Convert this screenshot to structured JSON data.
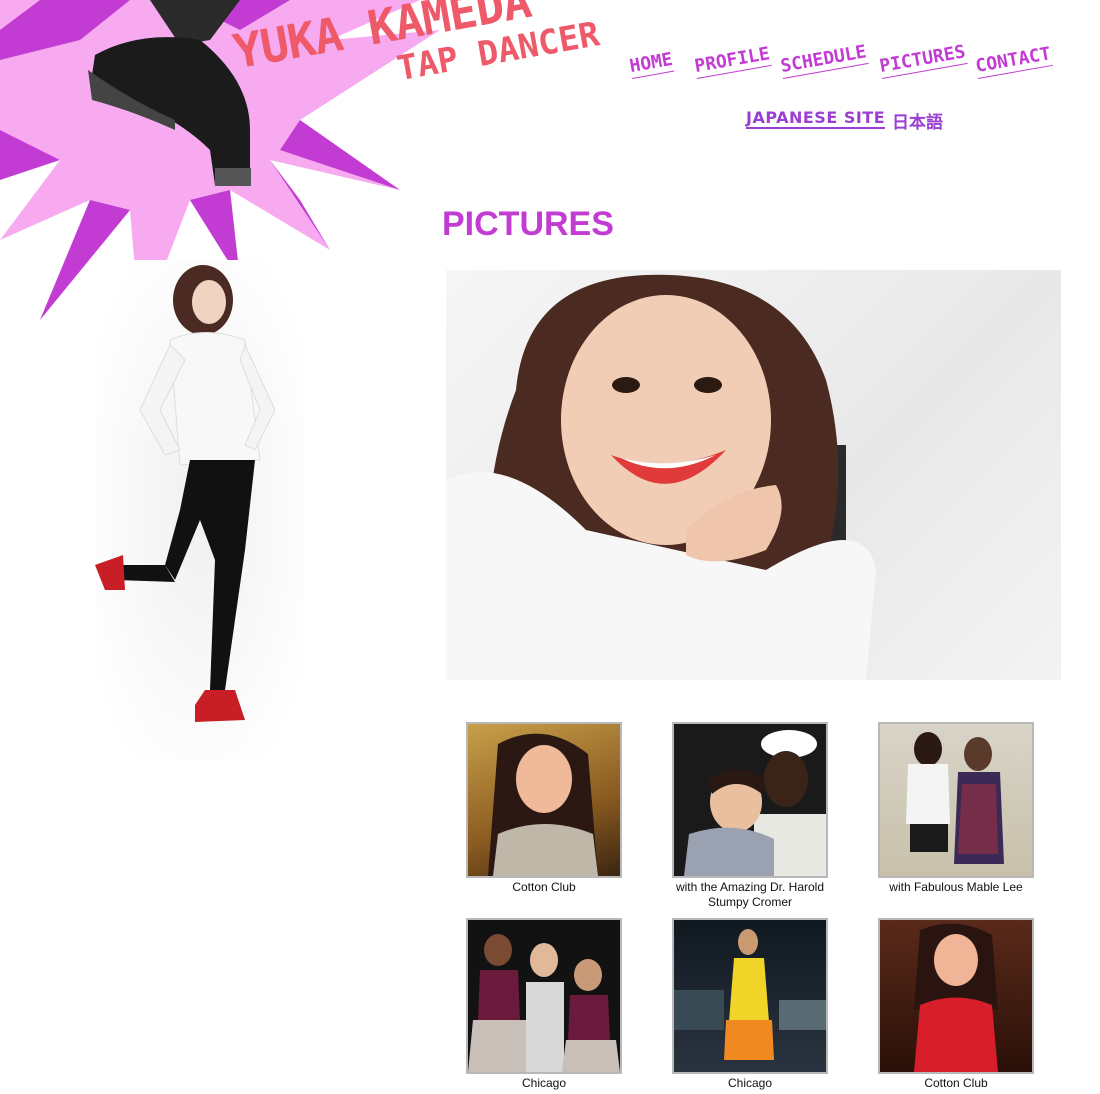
{
  "brand": {
    "name": "YUKA KAMEDA",
    "role": "TAP DANCER"
  },
  "nav": {
    "items": [
      {
        "label": "HOME"
      },
      {
        "label": "PROFILE"
      },
      {
        "label": "SCHEDULE"
      },
      {
        "label": "PICTURES"
      },
      {
        "label": "CONTACT"
      }
    ],
    "japanese_site": "JAPANESE SITE",
    "japanese_kanji": "日本語"
  },
  "page": {
    "title": "PICTURES"
  },
  "gallery": {
    "items": [
      {
        "caption": "Cotton Club"
      },
      {
        "caption": "with the Amazing Dr. Harold Stumpy Cromer"
      },
      {
        "caption": "with Fabulous Mable Lee"
      },
      {
        "caption": "Chicago"
      },
      {
        "caption": "Chicago"
      },
      {
        "caption": "Cotton Club"
      }
    ]
  },
  "colors": {
    "brand_pink": "#ef5a6a",
    "nav_magenta": "#c23cd3",
    "burst_light": "#f7aaf0",
    "burst_dark": "#c23cd3"
  }
}
